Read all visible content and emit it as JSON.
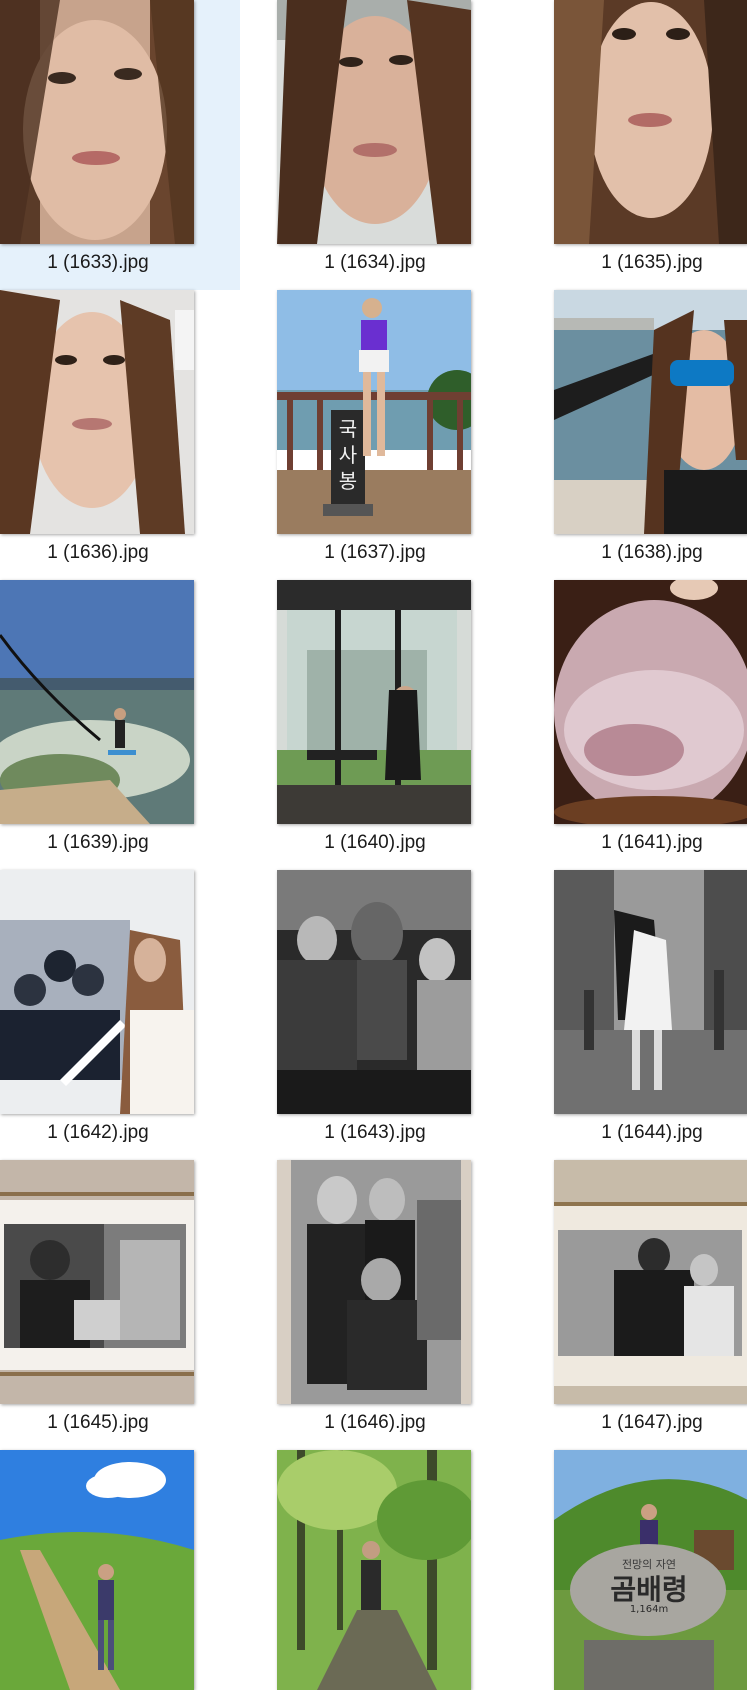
{
  "files": [
    {
      "name": "1 (1633).jpg",
      "icon": "selfie-photo-thumbnail",
      "selected": true
    },
    {
      "name": "1 (1634).jpg",
      "icon": "selfie-photo-thumbnail"
    },
    {
      "name": "1 (1635).jpg",
      "icon": "selfie-photo-thumbnail"
    },
    {
      "name": "1 (1636).jpg",
      "icon": "selfie-photo-thumbnail"
    },
    {
      "name": "1 (1637).jpg",
      "icon": "summit-marker-photo-thumbnail"
    },
    {
      "name": "1 (1638).jpg",
      "icon": "boat-selfie-photo-thumbnail"
    },
    {
      "name": "1 (1639).jpg",
      "icon": "wakesurf-photo-thumbnail"
    },
    {
      "name": "1 (1640).jpg",
      "icon": "cafe-photo-thumbnail"
    },
    {
      "name": "1 (1641).jpg",
      "icon": "smoke-dome-dish-photo-thumbnail"
    },
    {
      "name": "1 (1642).jpg",
      "icon": "gallery-photo-thumbnail"
    },
    {
      "name": "1 (1643).jpg",
      "icon": "bw-sculptor-photo-thumbnail"
    },
    {
      "name": "1 (1644).jpg",
      "icon": "bw-street-kiss-photo-thumbnail"
    },
    {
      "name": "1 (1645).jpg",
      "icon": "framed-bw-accordion-photo-thumbnail"
    },
    {
      "name": "1 (1646).jpg",
      "icon": "bw-group-portrait-photo-thumbnail"
    },
    {
      "name": "1 (1647).jpg",
      "icon": "framed-bw-photo-thumbnail"
    },
    {
      "name": "",
      "icon": "hiking-trail-photo-thumbnail"
    },
    {
      "name": "",
      "icon": "forest-photo-thumbnail"
    },
    {
      "name": "",
      "icon": "mountain-stone-marker-photo-thumbnail"
    }
  ],
  "overlay_text": {
    "summit_sign": "국사봉",
    "stone_title": "곰배령",
    "stone_sub": "전망의 자연",
    "stone_height": "1,164m"
  },
  "colors": {
    "selection": "#e5f1fb",
    "caption": "#1a1a1a"
  }
}
